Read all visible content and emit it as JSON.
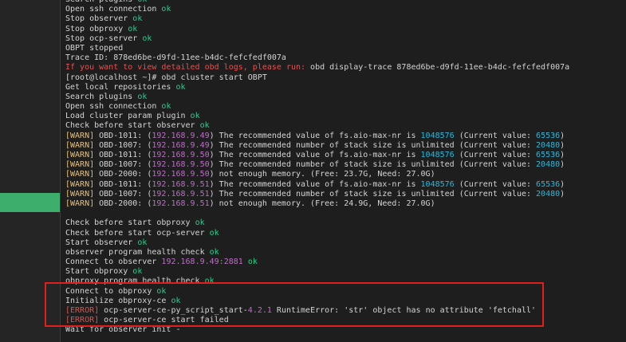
{
  "terminal": {
    "lines": [
      {
        "segs": [
          {
            "t": "Search plugins ",
            "c": ""
          },
          {
            "t": "ok",
            "c": "ok"
          }
        ]
      },
      {
        "segs": [
          {
            "t": "Open ssh connection ",
            "c": ""
          },
          {
            "t": "ok",
            "c": "ok"
          }
        ]
      },
      {
        "segs": [
          {
            "t": "Stop observer ",
            "c": ""
          },
          {
            "t": "ok",
            "c": "ok"
          }
        ]
      },
      {
        "segs": [
          {
            "t": "Stop obproxy ",
            "c": ""
          },
          {
            "t": "ok",
            "c": "ok"
          }
        ]
      },
      {
        "segs": [
          {
            "t": "Stop ocp-server ",
            "c": ""
          },
          {
            "t": "ok",
            "c": "ok"
          }
        ]
      },
      {
        "segs": [
          {
            "t": "OBPT stopped",
            "c": ""
          }
        ]
      },
      {
        "segs": [
          {
            "t": "Trace ID: 878ed6be-d9fd-11ee-b4dc-fefcfedf007a",
            "c": ""
          }
        ]
      },
      {
        "segs": [
          {
            "t": "If you want to view detailed obd logs, please run: obd display-trace 878ed6be-d9fd-11ee-b4dc-fefcfedf007a",
            "c": "mixed-trace"
          }
        ]
      },
      {
        "segs": [
          {
            "t": "[root@localhost ~]# obd cluster start OBPT",
            "c": ""
          }
        ]
      },
      {
        "segs": [
          {
            "t": "Get local repositories ",
            "c": ""
          },
          {
            "t": "ok",
            "c": "ok"
          }
        ]
      },
      {
        "segs": [
          {
            "t": "Search plugins ",
            "c": ""
          },
          {
            "t": "ok",
            "c": "ok"
          }
        ]
      },
      {
        "segs": [
          {
            "t": "Open ssh connection ",
            "c": ""
          },
          {
            "t": "ok",
            "c": "ok"
          }
        ]
      },
      {
        "segs": [
          {
            "t": "Load cluster param plugin ",
            "c": ""
          },
          {
            "t": "ok",
            "c": "ok"
          }
        ]
      },
      {
        "segs": [
          {
            "t": "Check before start observer ",
            "c": ""
          },
          {
            "t": "ok",
            "c": "ok"
          }
        ]
      },
      {
        "segs": [
          {
            "t": "[WARN]",
            "c": "warn"
          },
          {
            "t": " OBD-1011: (",
            "c": ""
          },
          {
            "t": "192.168.9.49",
            "c": "ip"
          },
          {
            "t": ") The recommended value of fs.aio-max-nr is ",
            "c": ""
          },
          {
            "t": "1048576",
            "c": "num"
          },
          {
            "t": " (Current value: ",
            "c": ""
          },
          {
            "t": "65536",
            "c": "num"
          },
          {
            "t": ")",
            "c": ""
          }
        ]
      },
      {
        "segs": [
          {
            "t": "[WARN]",
            "c": "warn"
          },
          {
            "t": " OBD-1007: (",
            "c": ""
          },
          {
            "t": "192.168.9.49",
            "c": "ip"
          },
          {
            "t": ") The recommended number of stack size is unlimited (Current value: ",
            "c": ""
          },
          {
            "t": "20480",
            "c": "num"
          },
          {
            "t": ")",
            "c": ""
          }
        ]
      },
      {
        "segs": [
          {
            "t": "[WARN]",
            "c": "warn"
          },
          {
            "t": " OBD-1011: (",
            "c": ""
          },
          {
            "t": "192.168.9.50",
            "c": "ip"
          },
          {
            "t": ") The recommended value of fs.aio-max-nr is ",
            "c": ""
          },
          {
            "t": "1048576",
            "c": "num"
          },
          {
            "t": " (Current value: ",
            "c": ""
          },
          {
            "t": "65536",
            "c": "num"
          },
          {
            "t": ")",
            "c": ""
          }
        ]
      },
      {
        "segs": [
          {
            "t": "[WARN]",
            "c": "warn"
          },
          {
            "t": " OBD-1007: (",
            "c": ""
          },
          {
            "t": "192.168.9.50",
            "c": "ip"
          },
          {
            "t": ") The recommended number of stack size is unlimited (Current value: ",
            "c": ""
          },
          {
            "t": "20480",
            "c": "num"
          },
          {
            "t": ")",
            "c": ""
          }
        ]
      },
      {
        "segs": [
          {
            "t": "[WARN]",
            "c": "warn"
          },
          {
            "t": " OBD-2000: (",
            "c": ""
          },
          {
            "t": "192.168.9.50",
            "c": "ip"
          },
          {
            "t": ") not enough memory. (Free: 23.7G, Need: 27.0G)",
            "c": ""
          }
        ]
      },
      {
        "segs": [
          {
            "t": "[WARN]",
            "c": "warn"
          },
          {
            "t": " OBD-1011: (",
            "c": ""
          },
          {
            "t": "192.168.9.51",
            "c": "ip"
          },
          {
            "t": ") The recommended value of fs.aio-max-nr is ",
            "c": ""
          },
          {
            "t": "1048576",
            "c": "num"
          },
          {
            "t": " (Current value: ",
            "c": ""
          },
          {
            "t": "65536",
            "c": "num"
          },
          {
            "t": ")",
            "c": ""
          }
        ]
      },
      {
        "segs": [
          {
            "t": "[WARN]",
            "c": "warn"
          },
          {
            "t": " OBD-1007: (",
            "c": ""
          },
          {
            "t": "192.168.9.51",
            "c": "ip"
          },
          {
            "t": ") The recommended number of stack size is unlimited (Current value: ",
            "c": ""
          },
          {
            "t": "20480",
            "c": "num"
          },
          {
            "t": ")",
            "c": ""
          }
        ]
      },
      {
        "segs": [
          {
            "t": "[WARN]",
            "c": "warn"
          },
          {
            "t": " OBD-2000: (",
            "c": ""
          },
          {
            "t": "192.168.9.51",
            "c": "ip"
          },
          {
            "t": ") not enough memory. (Free: 24.9G, Need: 27.0G)",
            "c": ""
          }
        ]
      },
      {
        "segs": [
          {
            "t": "",
            "c": ""
          }
        ]
      },
      {
        "segs": [
          {
            "t": "Check before start obproxy ",
            "c": ""
          },
          {
            "t": "ok",
            "c": "ok"
          }
        ]
      },
      {
        "segs": [
          {
            "t": "Check before start ocp-server ",
            "c": ""
          },
          {
            "t": "ok",
            "c": "ok"
          }
        ]
      },
      {
        "segs": [
          {
            "t": "Start observer ",
            "c": ""
          },
          {
            "t": "ok",
            "c": "ok"
          }
        ]
      },
      {
        "segs": [
          {
            "t": "observer program health check ",
            "c": ""
          },
          {
            "t": "ok",
            "c": "ok"
          }
        ]
      },
      {
        "segs": [
          {
            "t": "Connect to observer ",
            "c": ""
          },
          {
            "t": "192.168.9.49:2881",
            "c": "ip"
          },
          {
            "t": " ",
            "c": ""
          },
          {
            "t": "ok",
            "c": "ok"
          }
        ]
      },
      {
        "segs": [
          {
            "t": "Start obproxy ",
            "c": ""
          },
          {
            "t": "ok",
            "c": "ok"
          }
        ]
      },
      {
        "segs": [
          {
            "t": "obproxy program health check ",
            "c": ""
          },
          {
            "t": "ok",
            "c": "ok"
          }
        ]
      },
      {
        "segs": [
          {
            "t": "Connect to obproxy ",
            "c": ""
          },
          {
            "t": "ok",
            "c": "ok"
          }
        ]
      },
      {
        "segs": [
          {
            "t": "Initialize obproxy-ce ",
            "c": ""
          },
          {
            "t": "ok",
            "c": "ok"
          }
        ]
      },
      {
        "segs": [
          {
            "t": "[ERROR]",
            "c": "err-dim"
          },
          {
            "t": " ocp-server-ce-py_script_start-",
            "c": ""
          },
          {
            "t": "4.2.1",
            "c": "ip"
          },
          {
            "t": " RuntimeError: 'str' object has no attribute 'fetchall'",
            "c": ""
          }
        ]
      },
      {
        "segs": [
          {
            "t": "[ERROR]",
            "c": "err-dim"
          },
          {
            "t": " ocp-server-ce start failed",
            "c": ""
          }
        ]
      },
      {
        "segs": [
          {
            "t": "Wait for observer init -",
            "c": ""
          }
        ]
      }
    ],
    "trace_hint_prefix": "If you want to view detailed obd logs, please run: ",
    "trace_hint_command": "obd display-trace 878ed6be-d9fd-11ee-b4dc-fefcfedf007a"
  },
  "colors": {
    "background": "#1e1e1e",
    "ok": "#23d18b",
    "warn": "#e5c07b",
    "ip": "#bc6ec5",
    "number": "#29b8db",
    "error": "#f14c4c",
    "highlight_box": "#e01e1e",
    "sidebar_marker": "#3dae6c"
  }
}
